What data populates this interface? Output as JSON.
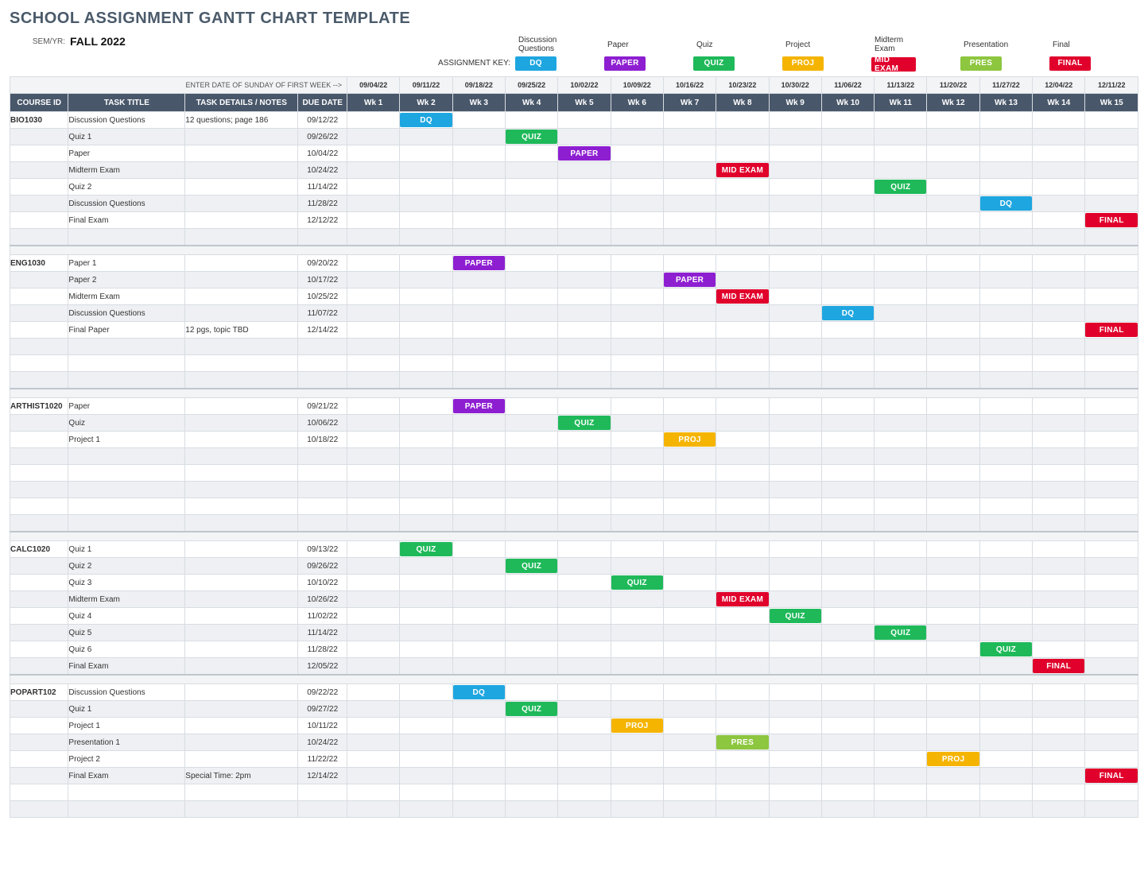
{
  "page": {
    "title": "SCHOOL ASSIGNMENT GANTT CHART TEMPLATE",
    "sem_label": "SEM/YR:",
    "sem_value": "FALL 2022",
    "key_title": "ASSIGNMENT KEY:",
    "date_note": "ENTER DATE OF SUNDAY OF FIRST WEEK -->"
  },
  "key_types": [
    {
      "name": "Discussion Questions",
      "short": "DQ",
      "cls": "dq"
    },
    {
      "name": "Paper",
      "short": "PAPER",
      "cls": "paper"
    },
    {
      "name": "Quiz",
      "short": "QUIZ",
      "cls": "quiz"
    },
    {
      "name": "Project",
      "short": "PROJ",
      "cls": "proj"
    },
    {
      "name": "Midterm Exam",
      "short": "MID EXAM",
      "cls": "midexam"
    },
    {
      "name": "Presentation",
      "short": "PRES",
      "cls": "pres"
    },
    {
      "name": "Final",
      "short": "FINAL",
      "cls": "final"
    }
  ],
  "columns": {
    "course": "COURSE ID",
    "task": "TASK TITLE",
    "notes": "TASK DETAILS / NOTES",
    "due": "DUE DATE"
  },
  "weeks": [
    {
      "date": "09/04/22",
      "label": "Wk 1"
    },
    {
      "date": "09/11/22",
      "label": "Wk 2"
    },
    {
      "date": "09/18/22",
      "label": "Wk 3"
    },
    {
      "date": "09/25/22",
      "label": "Wk 4"
    },
    {
      "date": "10/02/22",
      "label": "Wk 5"
    },
    {
      "date": "10/09/22",
      "label": "Wk 6"
    },
    {
      "date": "10/16/22",
      "label": "Wk 7"
    },
    {
      "date": "10/23/22",
      "label": "Wk 8"
    },
    {
      "date": "10/30/22",
      "label": "Wk 9"
    },
    {
      "date": "11/06/22",
      "label": "Wk 10"
    },
    {
      "date": "11/13/22",
      "label": "Wk 11"
    },
    {
      "date": "11/20/22",
      "label": "Wk 12"
    },
    {
      "date": "11/27/22",
      "label": "Wk 13"
    },
    {
      "date": "12/04/22",
      "label": "Wk 14"
    },
    {
      "date": "12/11/22",
      "label": "Wk 15"
    }
  ],
  "rows": [
    {
      "course": "BIO1030",
      "task": "Discussion Questions",
      "notes": "12 questions; page 186",
      "due": "09/12/22",
      "week": 2,
      "type": "dq"
    },
    {
      "course": "",
      "task": "Quiz 1",
      "notes": "",
      "due": "09/26/22",
      "week": 4,
      "type": "quiz",
      "alt": true
    },
    {
      "course": "",
      "task": "Paper",
      "notes": "",
      "due": "10/04/22",
      "week": 5,
      "type": "paper"
    },
    {
      "course": "",
      "task": "Midterm Exam",
      "notes": "",
      "due": "10/24/22",
      "week": 8,
      "type": "midexam",
      "alt": true
    },
    {
      "course": "",
      "task": "Quiz 2",
      "notes": "",
      "due": "11/14/22",
      "week": 11,
      "type": "quiz"
    },
    {
      "course": "",
      "task": "Discussion Questions",
      "notes": "",
      "due": "11/28/22",
      "week": 13,
      "type": "dq",
      "alt": true
    },
    {
      "course": "",
      "task": "Final Exam",
      "notes": "",
      "due": "12/12/22",
      "week": 15,
      "type": "final"
    },
    {
      "blank": true,
      "alt": true
    },
    {
      "gap": true
    },
    {
      "course": "ENG1030",
      "task": "Paper 1",
      "notes": "",
      "due": "09/20/22",
      "week": 3,
      "type": "paper"
    },
    {
      "course": "",
      "task": "Paper 2",
      "notes": "",
      "due": "10/17/22",
      "week": 7,
      "type": "paper",
      "alt": true
    },
    {
      "course": "",
      "task": "Midterm Exam",
      "notes": "",
      "due": "10/25/22",
      "week": 8,
      "type": "midexam"
    },
    {
      "course": "",
      "task": "Discussion Questions",
      "notes": "",
      "due": "11/07/22",
      "week": 10,
      "type": "dq",
      "alt": true
    },
    {
      "course": "",
      "task": "Final Paper",
      "notes": "12 pgs, topic TBD",
      "due": "12/14/22",
      "week": 15,
      "type": "final"
    },
    {
      "blank": true,
      "alt": true
    },
    {
      "blank": true
    },
    {
      "blank": true,
      "alt": true
    },
    {
      "gap": true
    },
    {
      "course": "ARTHIST1020",
      "task": "Paper",
      "notes": "",
      "due": "09/21/22",
      "week": 3,
      "type": "paper"
    },
    {
      "course": "",
      "task": "Quiz",
      "notes": "",
      "due": "10/06/22",
      "week": 5,
      "type": "quiz",
      "alt": true
    },
    {
      "course": "",
      "task": "Project 1",
      "notes": "",
      "due": "10/18/22",
      "week": 7,
      "type": "proj"
    },
    {
      "blank": true,
      "alt": true
    },
    {
      "blank": true
    },
    {
      "blank": true,
      "alt": true
    },
    {
      "blank": true
    },
    {
      "blank": true,
      "alt": true
    },
    {
      "gap": true
    },
    {
      "course": "CALC1020",
      "task": "Quiz 1",
      "notes": "",
      "due": "09/13/22",
      "week": 2,
      "type": "quiz"
    },
    {
      "course": "",
      "task": "Quiz 2",
      "notes": "",
      "due": "09/26/22",
      "week": 4,
      "type": "quiz",
      "alt": true
    },
    {
      "course": "",
      "task": "Quiz 3",
      "notes": "",
      "due": "10/10/22",
      "week": 6,
      "type": "quiz"
    },
    {
      "course": "",
      "task": "Midterm Exam",
      "notes": "",
      "due": "10/26/22",
      "week": 8,
      "type": "midexam",
      "alt": true
    },
    {
      "course": "",
      "task": "Quiz 4",
      "notes": "",
      "due": "11/02/22",
      "week": 9,
      "type": "quiz"
    },
    {
      "course": "",
      "task": "Quiz 5",
      "notes": "",
      "due": "11/14/22",
      "week": 11,
      "type": "quiz",
      "alt": true
    },
    {
      "course": "",
      "task": "Quiz 6",
      "notes": "",
      "due": "11/28/22",
      "week": 13,
      "type": "quiz"
    },
    {
      "course": "",
      "task": "Final Exam",
      "notes": "",
      "due": "12/05/22",
      "week": 14,
      "type": "final",
      "alt": true
    },
    {
      "gap": true
    },
    {
      "course": "POPART102",
      "task": "Discussion Questions",
      "notes": "",
      "due": "09/22/22",
      "week": 3,
      "type": "dq"
    },
    {
      "course": "",
      "task": "Quiz 1",
      "notes": "",
      "due": "09/27/22",
      "week": 4,
      "type": "quiz",
      "alt": true
    },
    {
      "course": "",
      "task": "Project 1",
      "notes": "",
      "due": "10/11/22",
      "week": 6,
      "type": "proj"
    },
    {
      "course": "",
      "task": "Presentation 1",
      "notes": "",
      "due": "10/24/22",
      "week": 8,
      "type": "pres",
      "alt": true
    },
    {
      "course": "",
      "task": "Project 2",
      "notes": "",
      "due": "11/22/22",
      "week": 12,
      "type": "proj"
    },
    {
      "course": "",
      "task": "Final Exam",
      "notes": "Special Time: 2pm",
      "due": "12/14/22",
      "week": 15,
      "type": "final",
      "alt": true
    },
    {
      "blank": true
    },
    {
      "blank": true,
      "alt": true
    }
  ],
  "chart_data": {
    "type": "table",
    "title": "School Assignment Gantt Chart — Fall 2022",
    "x": [
      "Wk 1",
      "Wk 2",
      "Wk 3",
      "Wk 4",
      "Wk 5",
      "Wk 6",
      "Wk 7",
      "Wk 8",
      "Wk 9",
      "Wk 10",
      "Wk 11",
      "Wk 12",
      "Wk 13",
      "Wk 14",
      "Wk 15"
    ],
    "x_dates": [
      "09/04/22",
      "09/11/22",
      "09/18/22",
      "09/25/22",
      "10/02/22",
      "10/09/22",
      "10/16/22",
      "10/23/22",
      "10/30/22",
      "11/06/22",
      "11/13/22",
      "11/20/22",
      "11/27/22",
      "12/04/22",
      "12/11/22"
    ],
    "series": [
      {
        "name": "BIO1030 – Discussion Questions",
        "type": "DQ",
        "due": "09/12/22",
        "week": 2
      },
      {
        "name": "BIO1030 – Quiz 1",
        "type": "QUIZ",
        "due": "09/26/22",
        "week": 4
      },
      {
        "name": "BIO1030 – Paper",
        "type": "PAPER",
        "due": "10/04/22",
        "week": 5
      },
      {
        "name": "BIO1030 – Midterm Exam",
        "type": "MID EXAM",
        "due": "10/24/22",
        "week": 8
      },
      {
        "name": "BIO1030 – Quiz 2",
        "type": "QUIZ",
        "due": "11/14/22",
        "week": 11
      },
      {
        "name": "BIO1030 – Discussion Questions",
        "type": "DQ",
        "due": "11/28/22",
        "week": 13
      },
      {
        "name": "BIO1030 – Final Exam",
        "type": "FINAL",
        "due": "12/12/22",
        "week": 15
      },
      {
        "name": "ENG1030 – Paper 1",
        "type": "PAPER",
        "due": "09/20/22",
        "week": 3
      },
      {
        "name": "ENG1030 – Paper 2",
        "type": "PAPER",
        "due": "10/17/22",
        "week": 7
      },
      {
        "name": "ENG1030 – Midterm Exam",
        "type": "MID EXAM",
        "due": "10/25/22",
        "week": 8
      },
      {
        "name": "ENG1030 – Discussion Questions",
        "type": "DQ",
        "due": "11/07/22",
        "week": 10
      },
      {
        "name": "ENG1030 – Final Paper",
        "type": "FINAL",
        "due": "12/14/22",
        "week": 15
      },
      {
        "name": "ARTHIST1020 – Paper",
        "type": "PAPER",
        "due": "09/21/22",
        "week": 3
      },
      {
        "name": "ARTHIST1020 – Quiz",
        "type": "QUIZ",
        "due": "10/06/22",
        "week": 5
      },
      {
        "name": "ARTHIST1020 – Project 1",
        "type": "PROJ",
        "due": "10/18/22",
        "week": 7
      },
      {
        "name": "CALC1020 – Quiz 1",
        "type": "QUIZ",
        "due": "09/13/22",
        "week": 2
      },
      {
        "name": "CALC1020 – Quiz 2",
        "type": "QUIZ",
        "due": "09/26/22",
        "week": 4
      },
      {
        "name": "CALC1020 – Quiz 3",
        "type": "QUIZ",
        "due": "10/10/22",
        "week": 6
      },
      {
        "name": "CALC1020 – Midterm Exam",
        "type": "MID EXAM",
        "due": "10/26/22",
        "week": 8
      },
      {
        "name": "CALC1020 – Quiz 4",
        "type": "QUIZ",
        "due": "11/02/22",
        "week": 9
      },
      {
        "name": "CALC1020 – Quiz 5",
        "type": "QUIZ",
        "due": "11/14/22",
        "week": 11
      },
      {
        "name": "CALC1020 – Quiz 6",
        "type": "QUIZ",
        "due": "11/28/22",
        "week": 13
      },
      {
        "name": "CALC1020 – Final Exam",
        "type": "FINAL",
        "due": "12/05/22",
        "week": 14
      },
      {
        "name": "POPART102 – Discussion Questions",
        "type": "DQ",
        "due": "09/22/22",
        "week": 3
      },
      {
        "name": "POPART102 – Quiz 1",
        "type": "QUIZ",
        "due": "09/27/22",
        "week": 4
      },
      {
        "name": "POPART102 – Project 1",
        "type": "PROJ",
        "due": "10/11/22",
        "week": 6
      },
      {
        "name": "POPART102 – Presentation 1",
        "type": "PRES",
        "due": "10/24/22",
        "week": 8
      },
      {
        "name": "POPART102 – Project 2",
        "type": "PROJ",
        "due": "11/22/22",
        "week": 12
      },
      {
        "name": "POPART102 – Final Exam",
        "type": "FINAL",
        "due": "12/14/22",
        "week": 15
      }
    ]
  }
}
